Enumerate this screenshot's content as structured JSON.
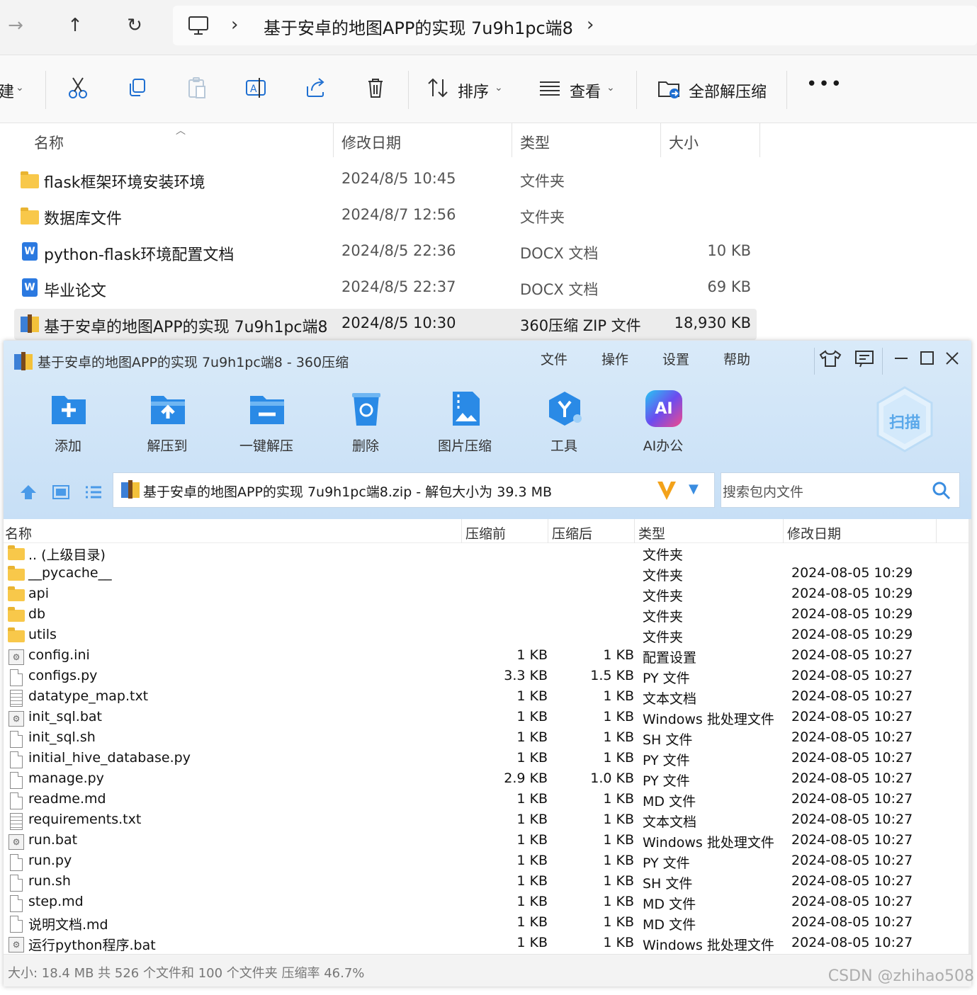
{
  "explorer": {
    "address_path": "基于安卓的地图APP的实现 7u9h1pc端8",
    "commands": {
      "new_partial": "建",
      "sort": "排序",
      "view": "查看",
      "extract_all": "全部解压缩"
    },
    "columns": [
      "名称",
      "修改日期",
      "类型",
      "大小"
    ],
    "rows": [
      {
        "name": "flask框架环境安装环境",
        "date": "2024/8/5 10:45",
        "type": "文件夹",
        "size": "",
        "icon": "folder-icon"
      },
      {
        "name": "数据库文件",
        "date": "2024/8/7 12:56",
        "type": "文件夹",
        "size": "",
        "icon": "folder-icon"
      },
      {
        "name": "python-flask环境配置文档",
        "date": "2024/8/5 22:36",
        "type": "DOCX 文档",
        "size": "10 KB",
        "icon": "word-doc-icon"
      },
      {
        "name": "毕业论文",
        "date": "2024/8/5 22:37",
        "type": "DOCX 文档",
        "size": "69 KB",
        "icon": "word-doc-icon"
      },
      {
        "name": "基于安卓的地图APP的实现 7u9h1pc端8",
        "date": "2024/8/5 10:30",
        "type": "360压缩 ZIP 文件",
        "size": "18,930 KB",
        "icon": "zip-archive-icon",
        "selected": true
      }
    ]
  },
  "zip": {
    "title": "基于安卓的地图APP的实现 7u9h1pc端8 - 360压缩",
    "menus": [
      "文件",
      "操作",
      "设置",
      "帮助"
    ],
    "tools": [
      {
        "label": "添加",
        "icon": "add-icon"
      },
      {
        "label": "解压到",
        "icon": "extract-to-icon"
      },
      {
        "label": "一键解压",
        "icon": "one-click-extract-icon"
      },
      {
        "label": "删除",
        "icon": "delete-icon"
      },
      {
        "label": "图片压缩",
        "icon": "image-compress-icon"
      },
      {
        "label": "工具",
        "icon": "tools-icon"
      },
      {
        "label": "AI办公",
        "icon": "ai-office-icon"
      }
    ],
    "ai_badge": "AI",
    "scan_label": "扫描",
    "path_text": "基于安卓的地图APP的实现 7u9h1pc端8.zip - 解包大小为 39.3 MB",
    "search_placeholder": "搜索包内文件",
    "columns": {
      "name": "名称",
      "before": "压缩前",
      "after": "压缩后",
      "type": "类型",
      "date": "修改日期"
    },
    "files": [
      {
        "name": ".. (上级目录)",
        "before": "",
        "after": "",
        "type": "文件夹",
        "date": "",
        "kind": "folder"
      },
      {
        "name": "__pycache__",
        "before": "",
        "after": "",
        "type": "文件夹",
        "date": "2024-08-05 10:29",
        "kind": "folder"
      },
      {
        "name": "api",
        "before": "",
        "after": "",
        "type": "文件夹",
        "date": "2024-08-05 10:29",
        "kind": "folder"
      },
      {
        "name": "db",
        "before": "",
        "after": "",
        "type": "文件夹",
        "date": "2024-08-05 10:29",
        "kind": "folder"
      },
      {
        "name": "utils",
        "before": "",
        "after": "",
        "type": "文件夹",
        "date": "2024-08-05 10:29",
        "kind": "folder"
      },
      {
        "name": "config.ini",
        "before": "1 KB",
        "after": "1 KB",
        "type": "配置设置",
        "date": "2024-08-05 10:27",
        "kind": "gear"
      },
      {
        "name": "configs.py",
        "before": "3.3 KB",
        "after": "1.5 KB",
        "type": "PY 文件",
        "date": "2024-08-05 10:27",
        "kind": "file"
      },
      {
        "name": "datatype_map.txt",
        "before": "1 KB",
        "after": "1 KB",
        "type": "文本文档",
        "date": "2024-08-05 10:27",
        "kind": "lines"
      },
      {
        "name": "init_sql.bat",
        "before": "1 KB",
        "after": "1 KB",
        "type": "Windows 批处理文件",
        "date": "2024-08-05 10:27",
        "kind": "gear"
      },
      {
        "name": "init_sql.sh",
        "before": "1 KB",
        "after": "1 KB",
        "type": "SH 文件",
        "date": "2024-08-05 10:27",
        "kind": "file"
      },
      {
        "name": "initial_hive_database.py",
        "before": "1 KB",
        "after": "1 KB",
        "type": "PY 文件",
        "date": "2024-08-05 10:27",
        "kind": "file"
      },
      {
        "name": "manage.py",
        "before": "2.9 KB",
        "after": "1.0 KB",
        "type": "PY 文件",
        "date": "2024-08-05 10:27",
        "kind": "file"
      },
      {
        "name": "readme.md",
        "before": "1 KB",
        "after": "1 KB",
        "type": "MD 文件",
        "date": "2024-08-05 10:27",
        "kind": "file"
      },
      {
        "name": "requirements.txt",
        "before": "1 KB",
        "after": "1 KB",
        "type": "文本文档",
        "date": "2024-08-05 10:27",
        "kind": "lines"
      },
      {
        "name": "run.bat",
        "before": "1 KB",
        "after": "1 KB",
        "type": "Windows 批处理文件",
        "date": "2024-08-05 10:27",
        "kind": "gear"
      },
      {
        "name": "run.py",
        "before": "1 KB",
        "after": "1 KB",
        "type": "PY 文件",
        "date": "2024-08-05 10:27",
        "kind": "file"
      },
      {
        "name": "run.sh",
        "before": "1 KB",
        "after": "1 KB",
        "type": "SH 文件",
        "date": "2024-08-05 10:27",
        "kind": "file"
      },
      {
        "name": "step.md",
        "before": "1 KB",
        "after": "1 KB",
        "type": "MD 文件",
        "date": "2024-08-05 10:27",
        "kind": "file"
      },
      {
        "name": "说明文档.md",
        "before": "1 KB",
        "after": "1 KB",
        "type": "MD 文件",
        "date": "2024-08-05 10:27",
        "kind": "file"
      },
      {
        "name": "运行python程序.bat",
        "before": "1 KB",
        "after": "1 KB",
        "type": "Windows 批处理文件",
        "date": "2024-08-05 10:27",
        "kind": "gear"
      }
    ],
    "status": "大小: 18.4 MB 共 526 个文件和 100 个文件夹 压缩率 46.7%"
  },
  "watermark": "CSDN @zhihao508",
  "colors": {
    "accent_blue": "#2a8ae6",
    "folder_yellow": "#f8c84a",
    "selection_gray": "#ececec",
    "zip_header_bg": "#d9eaf9"
  }
}
